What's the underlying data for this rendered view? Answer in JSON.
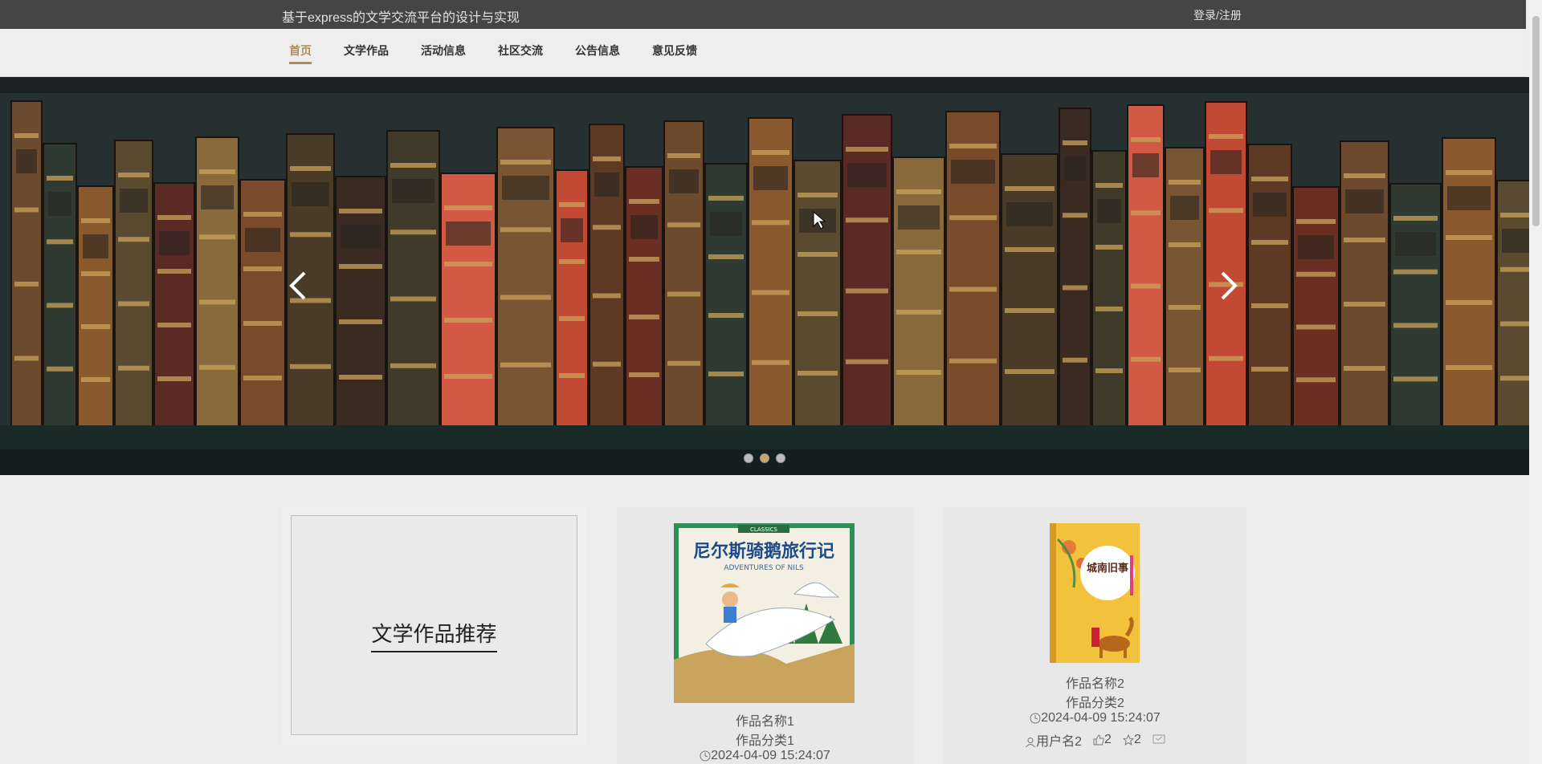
{
  "header": {
    "site_title": "基于express的文学交流平台的设计与实现",
    "login": "登录/注册"
  },
  "nav": {
    "items": [
      "首页",
      "文学作品",
      "活动信息",
      "社区交流",
      "公告信息",
      "意见反馈"
    ],
    "active": 0
  },
  "banner": {
    "dots": 3,
    "active_dot": 1
  },
  "section": {
    "title": "文学作品推荐"
  },
  "works": [
    {
      "name": "作品名称1",
      "category": "作品分类1",
      "time": "2024-04-09 15:24:07",
      "cover_title": "尼尔斯骑鹅旅行记",
      "cover_sub": "ADVENTURES OF NILS",
      "cover_badge": "CLASSICS"
    },
    {
      "name": "作品名称2",
      "category": "作品分类2",
      "time": "2024-04-09 15:24:07",
      "user": "用户名2",
      "likes": "2",
      "favs": "2",
      "cover_title": "城南旧事"
    }
  ],
  "colors": {
    "accent": "#b08c5a",
    "topbar": "#454545"
  }
}
